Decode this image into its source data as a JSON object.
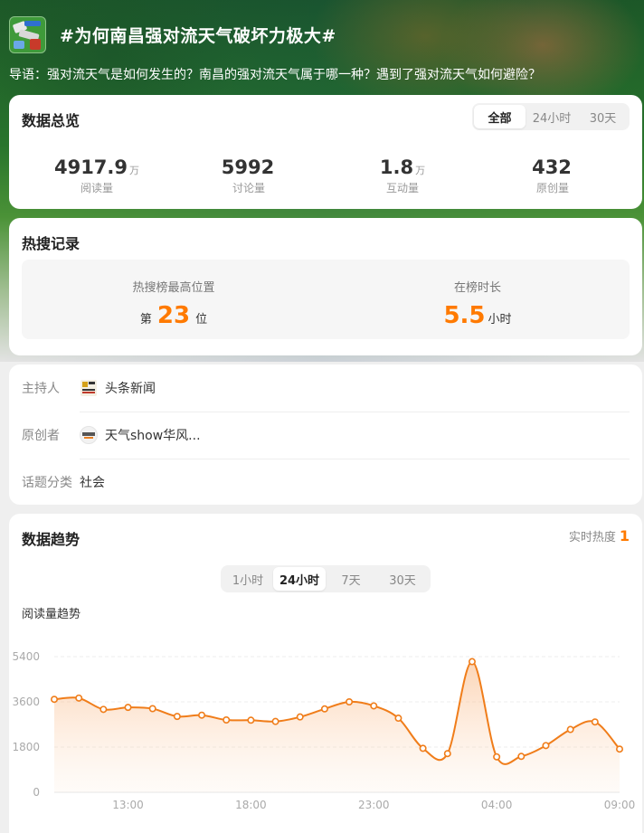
{
  "header": {
    "title": "#为何南昌强对流天气破坏力极大#",
    "intro": "导语：强对流天气是如何发生的？南昌的强对流天气属于哪一种？遇到了强对流天气如何避险？"
  },
  "overview": {
    "title": "数据总览",
    "tabs": [
      "全部",
      "24小时",
      "30天"
    ],
    "active_tab": "全部",
    "stats": [
      {
        "value": "4917.9",
        "unit": "万",
        "label": "阅读量"
      },
      {
        "value": "5992",
        "unit": "",
        "label": "讨论量"
      },
      {
        "value": "1.8",
        "unit": "万",
        "label": "互动量"
      },
      {
        "value": "432",
        "unit": "",
        "label": "原创量"
      }
    ]
  },
  "hot": {
    "title": "热搜记录",
    "peak_label": "热搜榜最高位置",
    "peak_prefix": "第",
    "peak_value": "23",
    "peak_suffix": "位",
    "duration_label": "在榜时长",
    "duration_value": "5.5",
    "duration_unit": "小时"
  },
  "info": {
    "host_key": "主持人",
    "host_value": "头条新闻",
    "creator_key": "原创者",
    "creator_value": "天气show华风...",
    "category_key": "话题分类",
    "category_value": "社会"
  },
  "trend": {
    "title": "数据趋势",
    "realtime_label": "实时热度",
    "realtime_value": "1",
    "tabs": [
      "1小时",
      "24小时",
      "7天",
      "30天"
    ],
    "active_tab": "24小时",
    "chart_label": "阅读量趋势"
  },
  "colors": {
    "accent": "#ff7a00",
    "line": "#f07d1a"
  },
  "chart_data": {
    "type": "area",
    "title": "阅读量趋势",
    "y_ticks": [
      0,
      1800,
      3600,
      5400
    ],
    "ylim": [
      0,
      5400
    ],
    "x_tick_labels": [
      "13:00",
      "18:00",
      "23:00",
      "04:00",
      "09:00"
    ],
    "x_tick_index": [
      3,
      8,
      13,
      18,
      23
    ],
    "grid": true,
    "series": [
      {
        "values": [
          3700,
          3750,
          3300,
          3380,
          3330,
          3020,
          3070,
          2880,
          2870,
          2820,
          3000,
          3320,
          3600,
          3440,
          2950,
          1750,
          1540,
          5200,
          1410,
          1430,
          1860,
          2500,
          2800,
          1720
        ]
      }
    ]
  }
}
